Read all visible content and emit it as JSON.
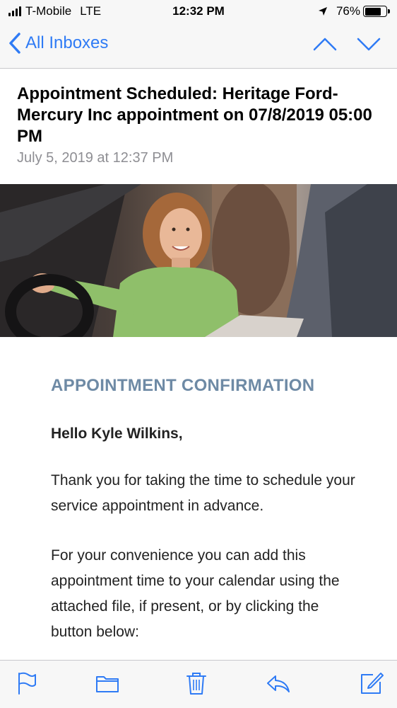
{
  "status_bar": {
    "carrier": "T-Mobile",
    "network": "LTE",
    "time": "12:32 PM",
    "battery": "76%",
    "battery_level": 0.76
  },
  "nav": {
    "back_label": "All Inboxes"
  },
  "message": {
    "subject": "Appointment Scheduled: Heritage Ford-Mercury Inc appointment on 07/8/2019 05:00 PM",
    "date": "July 5, 2019 at 12:37 PM"
  },
  "body": {
    "title": "APPOINTMENT CONFIRMATION",
    "greeting": "Hello Kyle Wilkins,",
    "paragraph1": "Thank you for taking the time to schedule your service appointment in advance.",
    "paragraph2": "For your convenience you can add this appointment time to your calendar using the attached file, if present, or by clicking the button below:"
  },
  "toolbar": {
    "icons": [
      "flag-icon",
      "folder-icon",
      "trash-icon",
      "reply-icon",
      "compose-icon"
    ]
  },
  "colors": {
    "accent": "#2f7bf5",
    "title_color": "#6e8aa5"
  }
}
